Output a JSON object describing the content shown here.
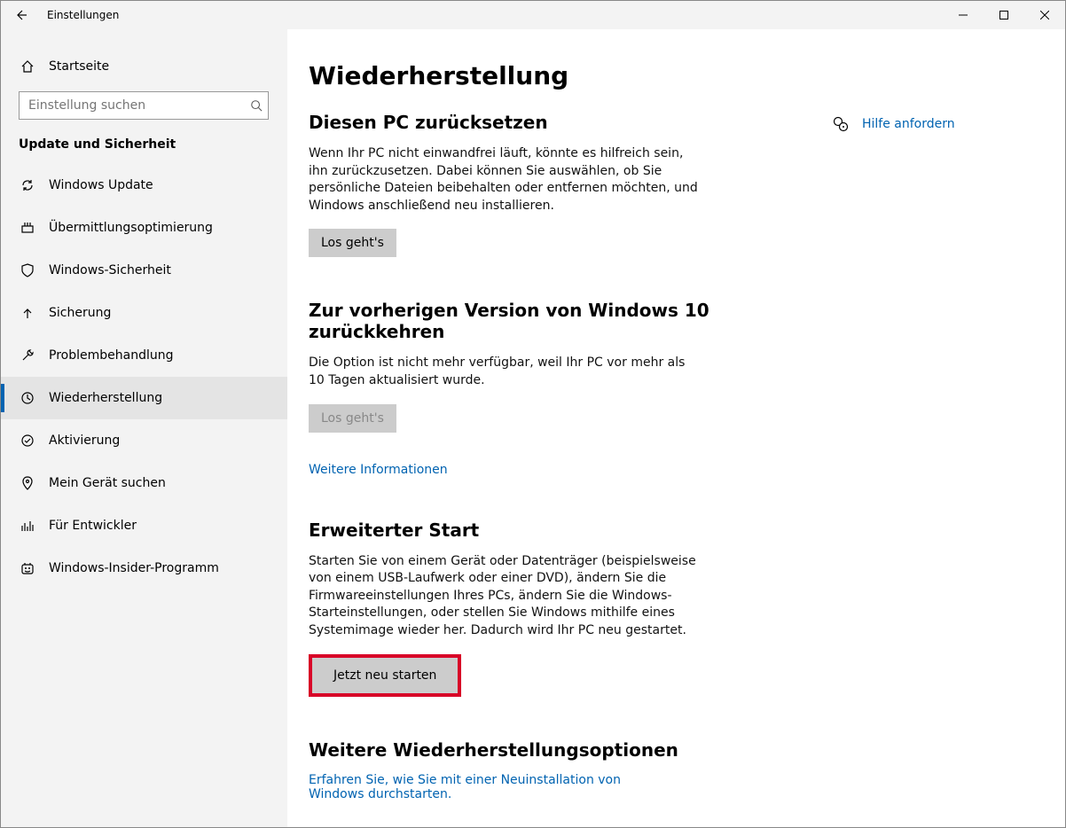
{
  "titlebar": {
    "title": "Einstellungen"
  },
  "sidebar": {
    "home": "Startseite",
    "search_placeholder": "Einstellung suchen",
    "category": "Update und Sicherheit",
    "items": [
      {
        "label": "Windows Update",
        "icon": "sync-icon",
        "active": false
      },
      {
        "label": "Übermittlungsoptimierung",
        "icon": "delivery-icon",
        "active": false
      },
      {
        "label": "Windows-Sicherheit",
        "icon": "shield-icon",
        "active": false
      },
      {
        "label": "Sicherung",
        "icon": "backup-arrow-icon",
        "active": false
      },
      {
        "label": "Problembehandlung",
        "icon": "troubleshoot-icon",
        "active": false
      },
      {
        "label": "Wiederherstellung",
        "icon": "recovery-icon",
        "active": true
      },
      {
        "label": "Aktivierung",
        "icon": "activation-icon",
        "active": false
      },
      {
        "label": "Mein Gerät suchen",
        "icon": "find-device-icon",
        "active": false
      },
      {
        "label": "Für Entwickler",
        "icon": "developer-icon",
        "active": false
      },
      {
        "label": "Windows-Insider-Programm",
        "icon": "insider-icon",
        "active": false
      }
    ]
  },
  "main": {
    "page_title": "Wiederherstellung",
    "reset": {
      "title": "Diesen PC zurücksetzen",
      "desc": "Wenn Ihr PC nicht einwandfrei läuft, könnte es hilfreich sein, ihn zurückzusetzen. Dabei können Sie auswählen, ob Sie persönliche Dateien beibehalten oder entfernen möchten, und Windows anschließend neu installieren.",
      "button": "Los geht's"
    },
    "goback": {
      "title": "Zur vorherigen Version von Windows 10 zurückkehren",
      "desc": "Die Option ist nicht mehr verfügbar, weil Ihr PC vor mehr als 10 Tagen aktualisiert wurde.",
      "button": "Los geht's",
      "link": "Weitere Informationen"
    },
    "advanced": {
      "title": "Erweiterter Start",
      "desc": "Starten Sie von einem Gerät oder Datenträger (beispielsweise von einem USB-Laufwerk oder einer DVD), ändern Sie die Firmwareeinstellungen Ihres PCs, ändern Sie die Windows-Starteinstellungen, oder stellen Sie Windows mithilfe eines Systemimage wieder her. Dadurch wird Ihr PC neu gestartet.",
      "button": "Jetzt neu starten"
    },
    "more": {
      "title": "Weitere Wiederherstellungsoptionen",
      "link": "Erfahren Sie, wie Sie mit einer Neuinstallation von Windows durchstarten."
    }
  },
  "right": {
    "help": "Hilfe anfordern"
  }
}
